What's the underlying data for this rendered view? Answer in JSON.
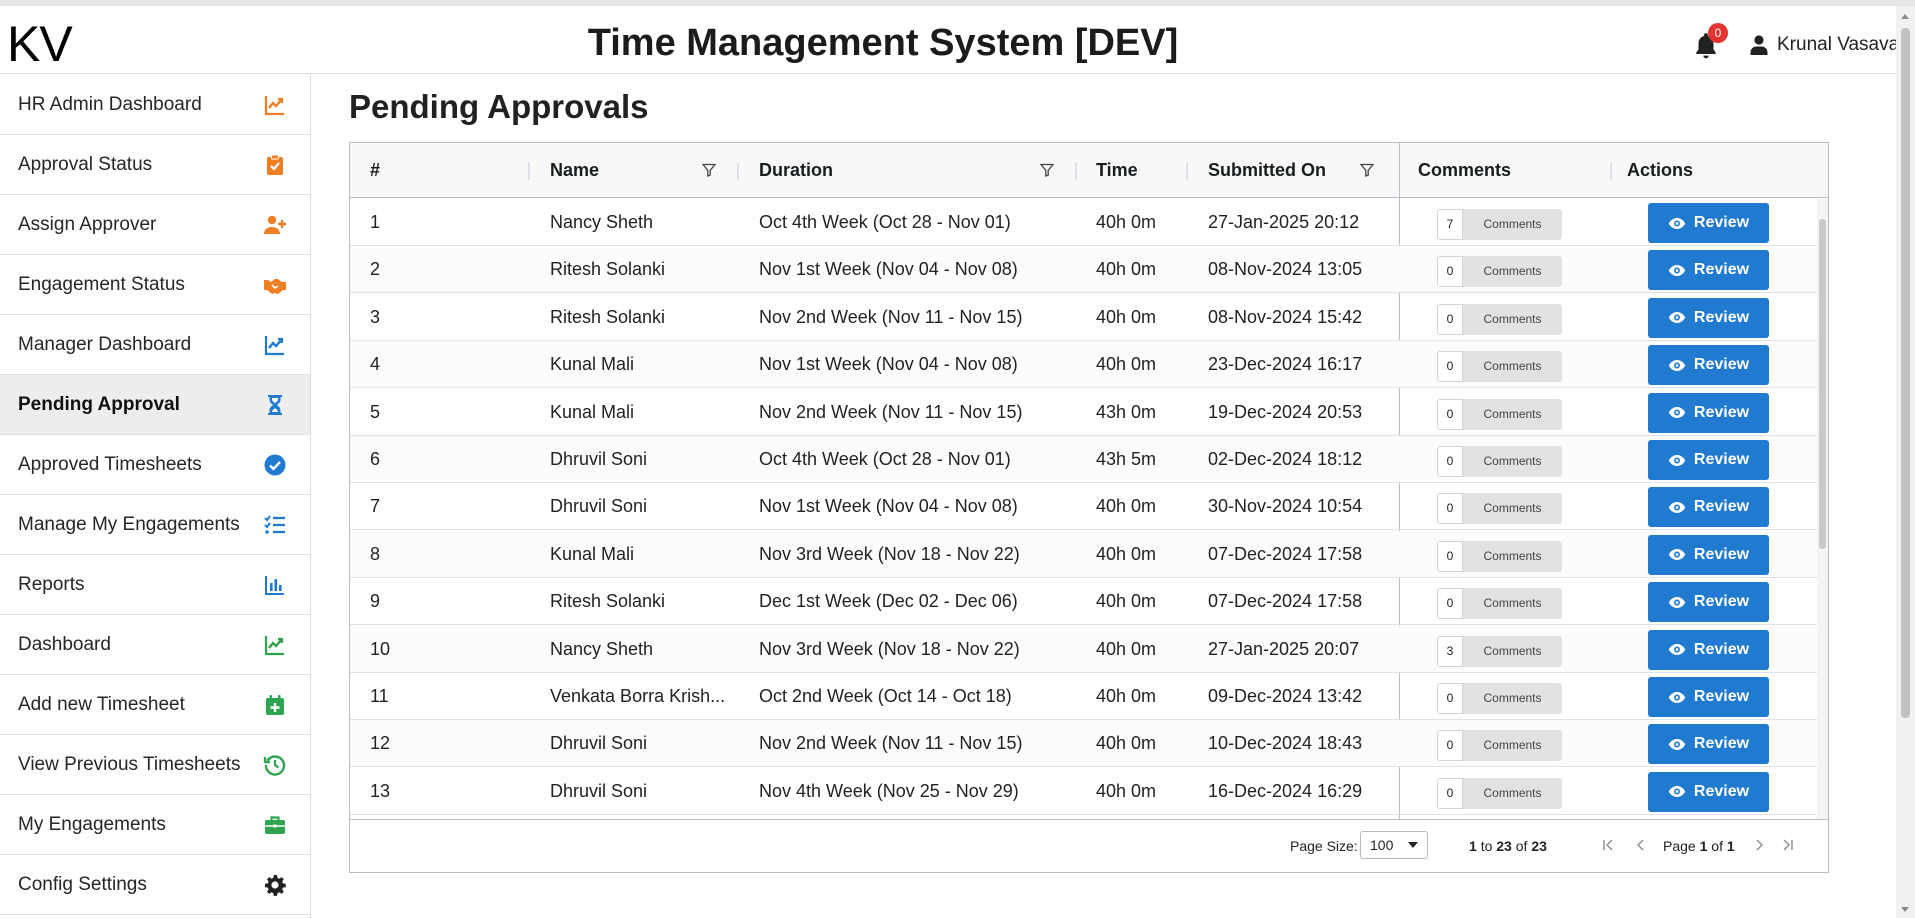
{
  "app": {
    "logo": "KV",
    "title": "Time Management System [DEV]",
    "notifications_count": "0",
    "user_name": "Krunal Vasava"
  },
  "sidebar": {
    "items": [
      {
        "label": "HR Admin Dashboard",
        "icon": "chart-line-icon",
        "color": "#f07f24"
      },
      {
        "label": "Approval Status",
        "icon": "clipboard-check-icon",
        "color": "#f07f24"
      },
      {
        "label": "Assign Approver",
        "icon": "user-plus-icon",
        "color": "#f07f24"
      },
      {
        "label": "Engagement Status",
        "icon": "handshake-icon",
        "color": "#f07f24"
      },
      {
        "label": "Manager Dashboard",
        "icon": "chart-line-icon",
        "color": "#1f7ad0"
      },
      {
        "label": "Pending Approval",
        "icon": "hourglass-icon",
        "color": "#1f7ad0",
        "active": true
      },
      {
        "label": "Approved Timesheets",
        "icon": "check-circle-icon",
        "color": "#1f7ad0"
      },
      {
        "label": "Manage My Engagements",
        "icon": "list-check-icon",
        "color": "#1f7ad0"
      },
      {
        "label": "Reports",
        "icon": "bar-chart-icon",
        "color": "#1f7ad0"
      },
      {
        "label": "Dashboard",
        "icon": "chart-line-icon",
        "color": "#2ea44f"
      },
      {
        "label": "Add new Timesheet",
        "icon": "calendar-plus-icon",
        "color": "#2ea44f"
      },
      {
        "label": "View Previous Timesheets",
        "icon": "history-icon",
        "color": "#2ea44f"
      },
      {
        "label": "My Engagements",
        "icon": "briefcase-icon",
        "color": "#2ea44f"
      },
      {
        "label": "Config Settings",
        "icon": "gear-icon",
        "color": "#222222"
      }
    ]
  },
  "page": {
    "title": "Pending Approvals"
  },
  "table": {
    "columns": {
      "index": "#",
      "name": "Name",
      "duration": "Duration",
      "time": "Time",
      "submitted": "Submitted On",
      "comments": "Comments",
      "actions": "Actions"
    },
    "comments_label": "Comments",
    "review_label": "Review",
    "rows": [
      {
        "idx": "1",
        "name": "Nancy Sheth",
        "duration": "Oct 4th Week (Oct 28 - Nov 01)",
        "time": "40h 0m",
        "submitted": "27-Jan-2025 20:12",
        "comments": "7"
      },
      {
        "idx": "2",
        "name": "Ritesh Solanki",
        "duration": "Nov 1st Week (Nov 04 - Nov 08)",
        "time": "40h 0m",
        "submitted": "08-Nov-2024 13:05",
        "comments": "0"
      },
      {
        "idx": "3",
        "name": "Ritesh Solanki",
        "duration": "Nov 2nd Week (Nov 11 - Nov 15)",
        "time": "40h 0m",
        "submitted": "08-Nov-2024 15:42",
        "comments": "0"
      },
      {
        "idx": "4",
        "name": "Kunal Mali",
        "duration": "Nov 1st Week (Nov 04 - Nov 08)",
        "time": "40h 0m",
        "submitted": "23-Dec-2024 16:17",
        "comments": "0"
      },
      {
        "idx": "5",
        "name": "Kunal Mali",
        "duration": "Nov 2nd Week (Nov 11 - Nov 15)",
        "time": "43h 0m",
        "submitted": "19-Dec-2024 20:53",
        "comments": "0"
      },
      {
        "idx": "6",
        "name": "Dhruvil Soni",
        "duration": "Oct 4th Week (Oct 28 - Nov 01)",
        "time": "43h 5m",
        "submitted": "02-Dec-2024 18:12",
        "comments": "0"
      },
      {
        "idx": "7",
        "name": "Dhruvil Soni",
        "duration": "Nov 1st Week (Nov 04 - Nov 08)",
        "time": "40h 0m",
        "submitted": "30-Nov-2024 10:54",
        "comments": "0"
      },
      {
        "idx": "8",
        "name": "Kunal Mali",
        "duration": "Nov 3rd Week (Nov 18 - Nov 22)",
        "time": "40h 0m",
        "submitted": "07-Dec-2024 17:58",
        "comments": "0"
      },
      {
        "idx": "9",
        "name": "Ritesh Solanki",
        "duration": "Dec 1st Week (Dec 02 - Dec 06)",
        "time": "40h 0m",
        "submitted": "07-Dec-2024 17:58",
        "comments": "0"
      },
      {
        "idx": "10",
        "name": "Nancy Sheth",
        "duration": "Nov 3rd Week (Nov 18 - Nov 22)",
        "time": "40h 0m",
        "submitted": "27-Jan-2025 20:07",
        "comments": "3"
      },
      {
        "idx": "11",
        "name": "Venkata Borra Krish...",
        "duration": "Oct 2nd Week (Oct 14 - Oct 18)",
        "time": "40h 0m",
        "submitted": "09-Dec-2024 13:42",
        "comments": "0"
      },
      {
        "idx": "12",
        "name": "Dhruvil Soni",
        "duration": "Nov 2nd Week (Nov 11 - Nov 15)",
        "time": "40h 0m",
        "submitted": "10-Dec-2024 18:43",
        "comments": "0"
      },
      {
        "idx": "13",
        "name": "Dhruvil Soni",
        "duration": "Nov 4th Week (Nov 25 - Nov 29)",
        "time": "40h 0m",
        "submitted": "16-Dec-2024 16:29",
        "comments": "0"
      }
    ]
  },
  "footer": {
    "page_size_label": "Page Size:",
    "page_size_value": "100",
    "from": "1",
    "to_word": "to",
    "to": "23",
    "of_word": "of",
    "total": "23",
    "page_word": "Page",
    "page": "1",
    "page_of_word": "of",
    "pages": "1"
  }
}
